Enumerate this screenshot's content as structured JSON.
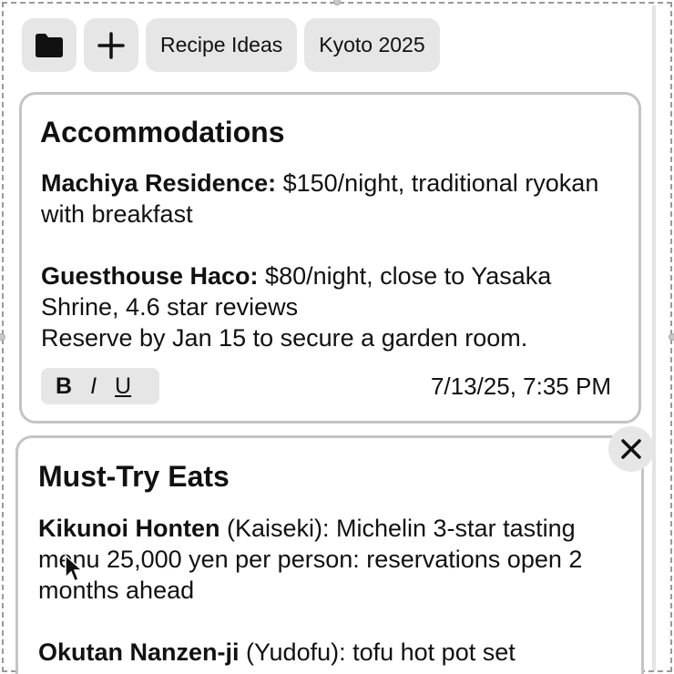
{
  "toolbar": {
    "folder_icon": "folder-icon",
    "add_icon": "plus-icon",
    "tabs": [
      "Recipe Ideas",
      "Kyoto 2025"
    ]
  },
  "cards": [
    {
      "title": "Accommodations",
      "entries": [
        {
          "name": "Machiya Residence:",
          "text": " $150/night, traditional ryokan with breakfast"
        },
        {
          "name": "Guesthouse Haco:",
          "text": " $80/night, close to Yasaka Shrine, 4.6 star reviews"
        }
      ],
      "note": "Reserve by Jan 15 to secure a garden room.",
      "format_buttons": {
        "bold": "B",
        "italic": "I",
        "underline": "U"
      },
      "timestamp": "7/13/25, 7:35 PM"
    },
    {
      "title": "Must-Try Eats",
      "entries": [
        {
          "name": "Kikunoi Honten",
          "text": " (Kaiseki): Michelin 3-star tasting menu 25,000 yen per person: reservations open 2 months ahead"
        },
        {
          "name": "Okutan Nanzen-ji",
          "text": " (Yudofu): tofu hot pot set"
        }
      ],
      "close_icon": "close-icon"
    }
  ]
}
